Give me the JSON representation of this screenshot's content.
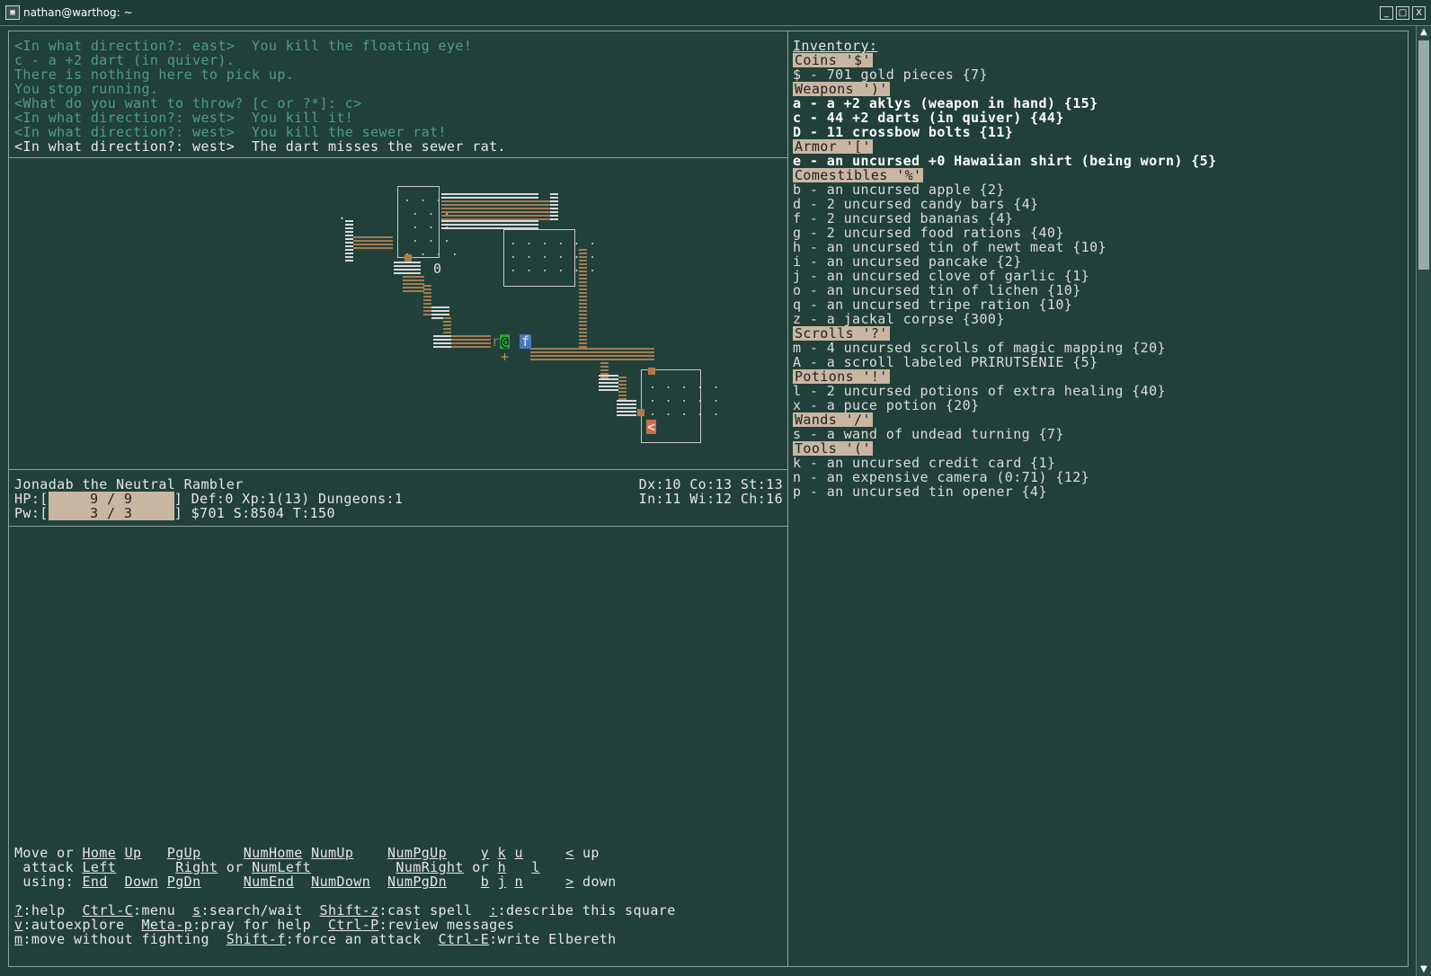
{
  "window": {
    "title": "nathan@warthog: ~",
    "controls": [
      "_",
      "□",
      "X"
    ]
  },
  "messages": [
    {
      "text": "<In what direction?: east>  You kill the floating eye!",
      "style": "old"
    },
    {
      "text": "c - a +2 dart (in quiver).",
      "style": "old"
    },
    {
      "text": "There is nothing here to pick up.",
      "style": "old"
    },
    {
      "text": "You stop running.",
      "style": "old"
    },
    {
      "text": "<What do you want to throw? [c or ?*]: c>",
      "style": "old"
    },
    {
      "text": "<In what direction?: west>  You kill it!",
      "style": "old"
    },
    {
      "text": "<In what direction?: west>  You kill the sewer rat!",
      "style": "old"
    },
    {
      "text": "<In what direction?: west>  The dart misses the sewer rat.",
      "style": "new"
    }
  ],
  "map": {
    "player": "@",
    "monster_r": "r",
    "pet": "f",
    "boulder": "0",
    "item_plus": "+",
    "stairs_up": "<",
    "dot_mark": "."
  },
  "status": {
    "name_line": "Jonadab the Neutral Rambler",
    "hp_label": "HP:[",
    "hp_value": "9 / 9",
    "hp_fraction": 1.0,
    "hp_rest": "] Def:0 Xp:1(13) Dungeons:1",
    "pw_label": "Pw:[",
    "pw_value": "3 / 3",
    "pw_fraction": 1.0,
    "pw_rest": "] $701 S:8504 T:150",
    "stats_line1": "Dx:10 Co:13 St:13",
    "stats_line2": "In:11 Wi:12 Ch:16"
  },
  "help": {
    "move_lines": [
      {
        "parts": [
          "Move or ",
          "<u>Home</u>",
          " ",
          "<u>Up</u>",
          "   ",
          "<u>PgUp</u>",
          "     ",
          "<u>NumHome</u>",
          " ",
          "<u>NumUp</u>",
          "    ",
          "<u>NumPgUp</u>",
          "    ",
          "<u>y</u>",
          " ",
          "<u>k</u>",
          " ",
          "<u>u</u>",
          "     ",
          "<u>&lt;</u>",
          " up"
        ]
      },
      {
        "parts": [
          " attack ",
          "<u>Left</u>",
          "       ",
          "<u>Right</u>",
          " or ",
          "<u>NumLeft</u>",
          "          ",
          "<u>NumRight</u>",
          " or ",
          "<u>h</u>",
          "   ",
          "<u>l</u>"
        ]
      },
      {
        "parts": [
          " using: ",
          "<u>End</u>",
          "  ",
          "<u>Down</u>",
          " ",
          "<u>PgDn</u>",
          "     ",
          "<u>NumEnd</u>",
          "  ",
          "<u>NumDown</u>",
          "  ",
          "<u>NumPgDn</u>",
          "    ",
          "<u>b</u>",
          " ",
          "<u>j</u>",
          " ",
          "<u>n</u>",
          "     ",
          "<u>&gt;</u>",
          " down"
        ]
      }
    ],
    "cmd_lines": [
      {
        "parts": [
          "<u>?</u>",
          ":help  ",
          "<u>Ctrl-C</u>",
          ":menu  ",
          "<u>s</u>",
          ":search/wait  ",
          "<u>Shift-z</u>",
          ":cast spell  ",
          "<u>:</u>",
          ":describe this square"
        ]
      },
      {
        "parts": [
          "<u>v</u>",
          ":autoexplore  ",
          "<u>Meta-p</u>",
          ":pray for help  ",
          "<u>Ctrl-P</u>",
          ":review messages"
        ]
      },
      {
        "parts": [
          "<u>m</u>",
          ":move without fighting  ",
          "<u>Shift-f</u>",
          ":force an attack  ",
          "<u>Ctrl-E</u>",
          ":write Elbereth"
        ]
      }
    ]
  },
  "inventory": {
    "title": "Inventory:",
    "categories": [
      {
        "name": "Coins '$'",
        "items": [
          "$ - 701 gold pieces {7}"
        ],
        "bright": false
      },
      {
        "name": "Weapons ')'",
        "items": [
          "a - a +2 aklys (weapon in hand) {15}",
          "c - 44 +2 darts (in quiver) {44}",
          "D - 11 crossbow bolts {11}"
        ],
        "bright": true
      },
      {
        "name": "Armor '['",
        "items": [
          "e - an uncursed +0 Hawaiian shirt (being worn) {5}"
        ],
        "bright": true
      },
      {
        "name": "Comestibles '%'",
        "items": [
          "b - an uncursed apple {2}",
          "d - 2 uncursed candy bars {4}",
          "f - 2 uncursed bananas {4}",
          "g - 2 uncursed food rations {40}",
          "h - an uncursed tin of newt meat {10}",
          "i - an uncursed pancake {2}",
          "j - an uncursed clove of garlic {1}",
          "o - an uncursed tin of lichen {10}",
          "q - an uncursed tripe ration {10}",
          "z - a jackal corpse {300}"
        ],
        "bright": false
      },
      {
        "name": "Scrolls '?'",
        "items": [
          "m - 4 uncursed scrolls of magic mapping {20}",
          "A - a scroll labeled PRIRUTSENIE {5}"
        ],
        "bright": false
      },
      {
        "name": "Potions '!'",
        "items": [
          "l - 2 uncursed potions of extra healing {40}",
          "x - a puce potion {20}"
        ],
        "bright": false
      },
      {
        "name": "Wands '/'",
        "items": [
          "s - a wand of undead turning {7}"
        ],
        "bright": false
      },
      {
        "name": "Tools '('",
        "items": [
          "k - an uncursed credit card {1}",
          "n - an expensive camera (0:71) {12}",
          "p - an uncursed tin opener {4}"
        ],
        "bright": false
      }
    ]
  },
  "colors": {
    "background": "#21403a",
    "message_old": "#4e9c8c",
    "category_bg": "#c9b6a2",
    "corridor": "#a67c52",
    "player_bg": "#1fa63a",
    "pet_bg": "#4a78b8"
  }
}
